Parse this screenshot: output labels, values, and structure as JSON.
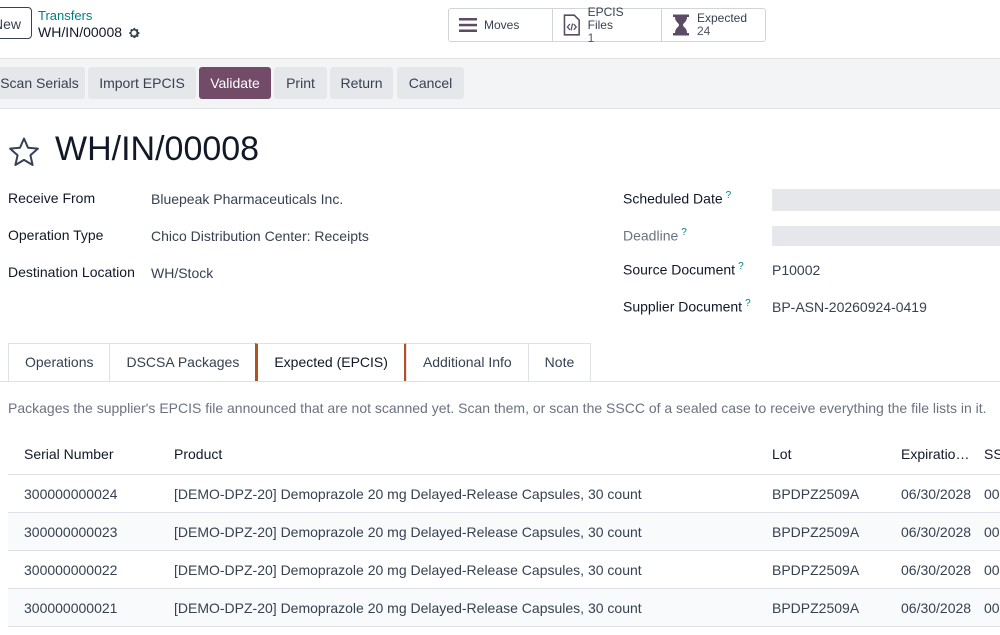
{
  "breadcrumb": {
    "new_label": "New",
    "parent": "Transfers",
    "current": "WH/IN/00008"
  },
  "smart_buttons": {
    "moves": {
      "label": "Moves"
    },
    "epcis_files": {
      "label": "EPCIS Files",
      "value": "1"
    },
    "expected": {
      "label": "Expected",
      "value": "24"
    }
  },
  "actions": [
    "Scan Serials",
    "Import EPCIS",
    "Validate",
    "Print",
    "Return",
    "Cancel"
  ],
  "record": {
    "title": "WH/IN/00008"
  },
  "fields_left": [
    {
      "label": "Receive From",
      "value": "Bluepeak Pharmaceuticals Inc."
    },
    {
      "label": "Operation Type",
      "value": "Chico Distribution Center: Receipts"
    },
    {
      "label": "Destination Location",
      "value": "WH/Stock"
    }
  ],
  "fields_right": [
    {
      "label": "Scheduled Date",
      "help": "?",
      "value": ""
    },
    {
      "label": "Deadline",
      "help": "?",
      "value": ""
    },
    {
      "label": "Source Document",
      "help": "?",
      "value": "P10002"
    },
    {
      "label": "Supplier Document",
      "help": "?",
      "value": "BP-ASN-20260924-0419"
    }
  ],
  "tabs": [
    "Operations",
    "DSCSA Packages",
    "Expected (EPCIS)",
    "Additional Info",
    "Note"
  ],
  "help_text": "Packages the supplier's EPCIS file announced that are not scanned yet. Scan them, or scan the SSCC of a sealed case to receive everything the file lists in it.",
  "table": {
    "columns": [
      "Serial Number",
      "Product",
      "Lot",
      "Expiratio…",
      "SS"
    ],
    "rows": [
      [
        "300000000024",
        "[DEMO-DPZ-20] Demoprazole 20 mg Delayed-Release Capsules, 30 count",
        "BPDPZ2509A",
        "06/30/2028",
        "00"
      ],
      [
        "300000000023",
        "[DEMO-DPZ-20] Demoprazole 20 mg Delayed-Release Capsules, 30 count",
        "BPDPZ2509A",
        "06/30/2028",
        "00"
      ],
      [
        "300000000022",
        "[DEMO-DPZ-20] Demoprazole 20 mg Delayed-Release Capsules, 30 count",
        "BPDPZ2509A",
        "06/30/2028",
        "00"
      ],
      [
        "300000000021",
        "[DEMO-DPZ-20] Demoprazole 20 mg Delayed-Release Capsules, 30 count",
        "BPDPZ2509A",
        "06/30/2028",
        "00"
      ]
    ]
  },
  "colors": {
    "primary": "#714b67",
    "link": "#017e84",
    "tab_accent": "#b4521f"
  }
}
